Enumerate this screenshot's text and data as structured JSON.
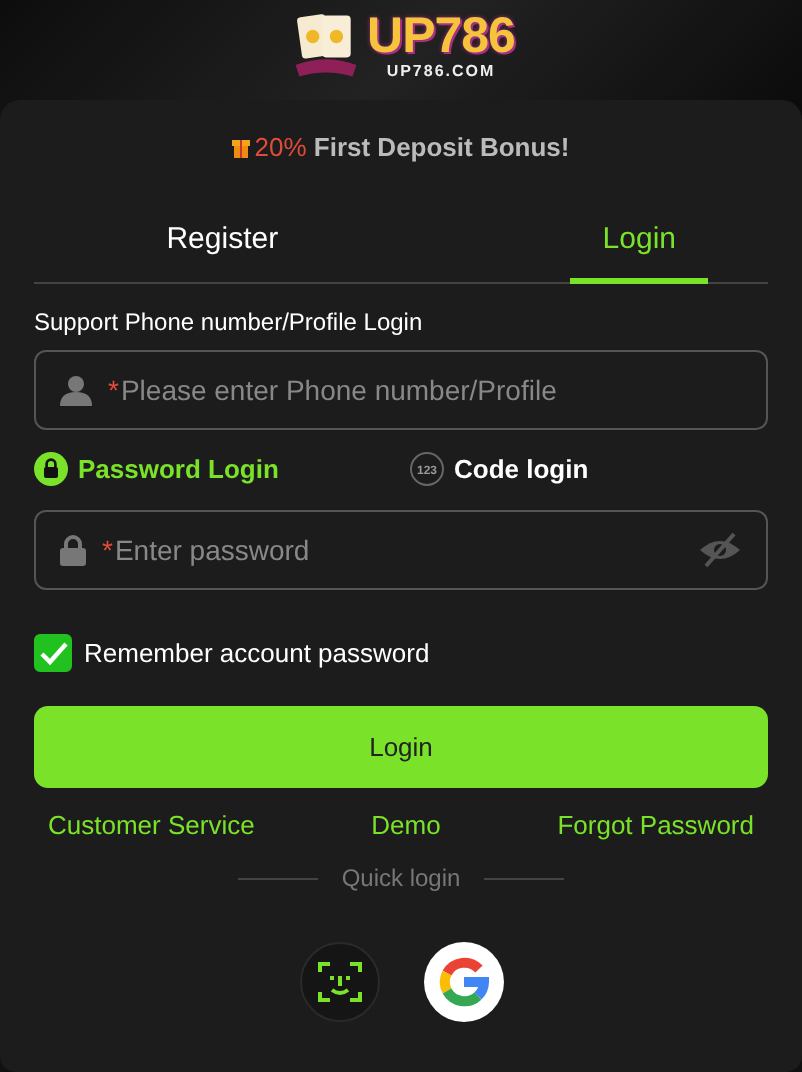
{
  "logo": {
    "title": "UP786",
    "domain": "UP786.COM"
  },
  "bonus": {
    "highlight": "20%",
    "text": "First Deposit Bonus!"
  },
  "tabs": [
    {
      "label": "Register",
      "selected": false
    },
    {
      "label": "Login",
      "selected": true
    }
  ],
  "account": {
    "label": "Support Phone number/Profile Login",
    "marker": "*",
    "placeholder": "Please enter Phone number/Profile"
  },
  "login_modes": [
    {
      "kind": "password",
      "label": "Password Login",
      "selected": true
    },
    {
      "kind": "code",
      "icon_text": "123",
      "label": "Code login",
      "selected": false
    }
  ],
  "password": {
    "marker": "*",
    "placeholder": "Enter password"
  },
  "remember": {
    "label": "Remember account password",
    "checked": true
  },
  "login_button": "Login",
  "links": [
    "Customer Service",
    "Demo",
    "Forgot Password"
  ],
  "quick_login": {
    "label": "Quick login",
    "methods": [
      {
        "kind": "face"
      },
      {
        "kind": "google"
      }
    ]
  }
}
